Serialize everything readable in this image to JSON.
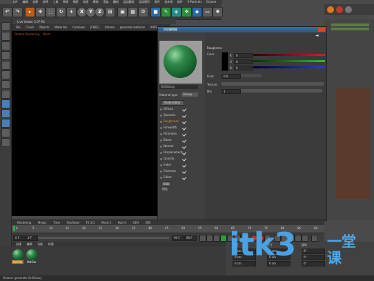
{
  "menubar": {
    "items": [
      "文件",
      "编辑",
      "创建",
      "选择",
      "工具",
      "网格",
      "捕捉",
      "动画",
      "模拟",
      "渲染",
      "雕刻",
      "运动跟踪",
      "运动图形",
      "角色",
      "流水线",
      "插件",
      "X-Particles",
      "Octane",
      "Redshift",
      "脚本",
      "窗口",
      "帮助"
    ]
  },
  "toolbar": {
    "axis": [
      "X",
      "Y",
      "Z"
    ]
  },
  "viewport": {
    "title": "Live Viewer 3.07-R2",
    "menu": [
      "File",
      "Cloud",
      "Objects",
      "Materials",
      "Compare",
      "[FREE]",
      "Octane",
      "generate material",
      "(VXGloss)",
      "Chn",
      "DL"
    ],
    "status": "Octane Rendering... Mesh..."
  },
  "dialog": {
    "title": "材质编辑器",
    "material_name": "OctGlossy",
    "material_type_label": "Material type",
    "material_type_value": "Glossy",
    "node_editor": "Node Editor",
    "channels": [
      "Diffuse",
      "Specular",
      "Roughness",
      "Filmwidth",
      "Filmindex",
      "Bump",
      "Normal",
      "Displacement",
      "Opacity",
      "Index",
      "Common",
      "Editor"
    ],
    "active_channel": "Roughness",
    "hide_label": "Hide",
    "assign_label": "指定",
    "section_title": "Roughness",
    "color_label": "Color",
    "rgb": [
      {
        "label": "R",
        "value": "0"
      },
      {
        "label": "G",
        "value": "0"
      },
      {
        "label": "B",
        "value": "0"
      }
    ],
    "float_label": "Float",
    "float_value": "0.0",
    "texture_label": "Texture",
    "mix_label": "Mix",
    "mix_value": "1",
    "bottom_status": "节点编辑器 100 cm",
    "accent_color": "#e08a30"
  },
  "timeline": {
    "top_items": [
      "Rendering",
      "Mysec",
      "Time",
      "Tex/Voxel",
      "FX 1/1",
      "Mesh 1",
      "Hair 0",
      "GPU",
      "VRC"
    ],
    "ruler": [
      "0",
      "5",
      "10",
      "15",
      "20",
      "25",
      "30",
      "35",
      "40",
      "45",
      "50",
      "55",
      "60",
      "65",
      "70",
      "75",
      "80",
      "85",
      "90"
    ],
    "start": "0 F",
    "current": "0 F",
    "end": "90 F",
    "end2": "90 F"
  },
  "material_manager": {
    "menu": [
      "创建",
      "编辑",
      "功能",
      "纹理"
    ],
    "materials": [
      "OctGlo",
      "OctGlo"
    ]
  },
  "attributes": {
    "fields": [
      "0 cm",
      "0 cm",
      "0 cm",
      "0 cm",
      "0 cm",
      "0 cm",
      "0°",
      "0°",
      "0°"
    ],
    "labels": [
      "位置",
      "尺寸",
      "旋转"
    ]
  },
  "statusbar": "Octane: generate OctGlossy",
  "watermark": {
    "latin": "itk3",
    "cn": "一堂课",
    "color": "#4aa8ef"
  }
}
